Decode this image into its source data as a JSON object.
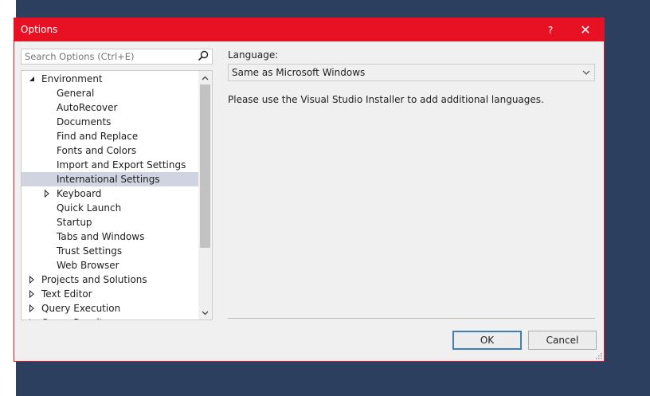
{
  "dialog": {
    "title": "Options",
    "help_label": "?",
    "close_label": "✕"
  },
  "search": {
    "placeholder": "Search Options (Ctrl+E)"
  },
  "tree": {
    "items": [
      {
        "label": "Environment",
        "level": 0,
        "expander": "expanded"
      },
      {
        "label": "General",
        "level": 1,
        "expander": "none"
      },
      {
        "label": "AutoRecover",
        "level": 1,
        "expander": "none"
      },
      {
        "label": "Documents",
        "level": 1,
        "expander": "none"
      },
      {
        "label": "Find and Replace",
        "level": 1,
        "expander": "none"
      },
      {
        "label": "Fonts and Colors",
        "level": 1,
        "expander": "none"
      },
      {
        "label": "Import and Export Settings",
        "level": 1,
        "expander": "none"
      },
      {
        "label": "International Settings",
        "level": 1,
        "expander": "none",
        "selected": true
      },
      {
        "label": "Keyboard",
        "level": 1,
        "expander": "collapsed"
      },
      {
        "label": "Quick Launch",
        "level": 1,
        "expander": "none"
      },
      {
        "label": "Startup",
        "level": 1,
        "expander": "none"
      },
      {
        "label": "Tabs and Windows",
        "level": 1,
        "expander": "none"
      },
      {
        "label": "Trust Settings",
        "level": 1,
        "expander": "none"
      },
      {
        "label": "Web Browser",
        "level": 1,
        "expander": "none"
      },
      {
        "label": "Projects and Solutions",
        "level": 0,
        "expander": "collapsed"
      },
      {
        "label": "Text Editor",
        "level": 0,
        "expander": "collapsed"
      },
      {
        "label": "Query Execution",
        "level": 0,
        "expander": "collapsed"
      },
      {
        "label": "Query Results",
        "level": 0,
        "expander": "collapsed"
      }
    ]
  },
  "content": {
    "language_label": "Language:",
    "language_value": "Same as Microsoft Windows",
    "info_text": "Please use the Visual Studio Installer to add additional languages."
  },
  "buttons": {
    "ok": "OK",
    "cancel": "Cancel"
  },
  "colors": {
    "accent": "#e81123",
    "background": "#2d3f5e",
    "selection": "#cfd4e0"
  }
}
